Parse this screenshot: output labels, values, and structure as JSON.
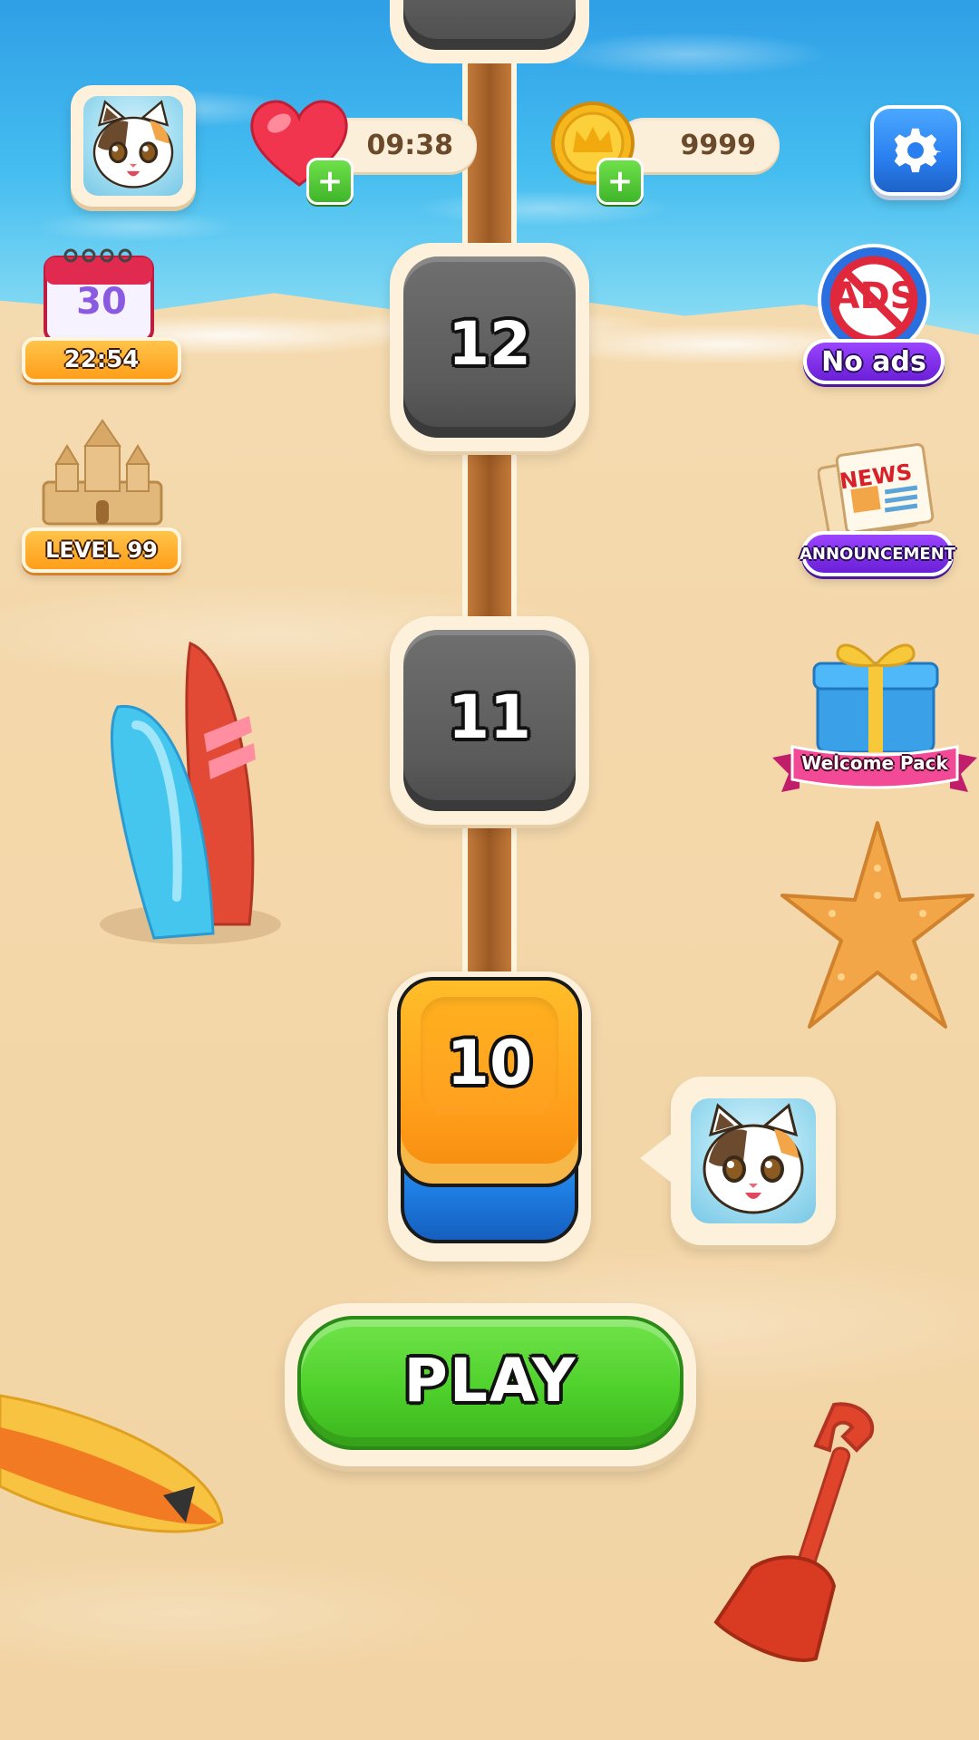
{
  "hud": {
    "lives_timer": "09:38",
    "coins": "9999"
  },
  "side_left": {
    "daily_calendar_day": "30",
    "daily_timer": "22:54",
    "level_label": "LEVEL 99"
  },
  "side_right": {
    "no_ads_badge": "ADS",
    "no_ads_label": "No ads",
    "news_badge": "NEWS",
    "announcement_label": "ANNOUNCEMENT",
    "welcome_pack_label": "Welcome Pack"
  },
  "levels": {
    "upper": "12",
    "middle": "11",
    "current": "10"
  },
  "play_button": "PLAY",
  "colors": {
    "play_green": "#4fd12c",
    "settings_blue": "#2a7ff0",
    "orange_tile": "#ff9e1a",
    "locked_tile": "#5b5b5b",
    "purple_label": "#6a1fd6"
  }
}
